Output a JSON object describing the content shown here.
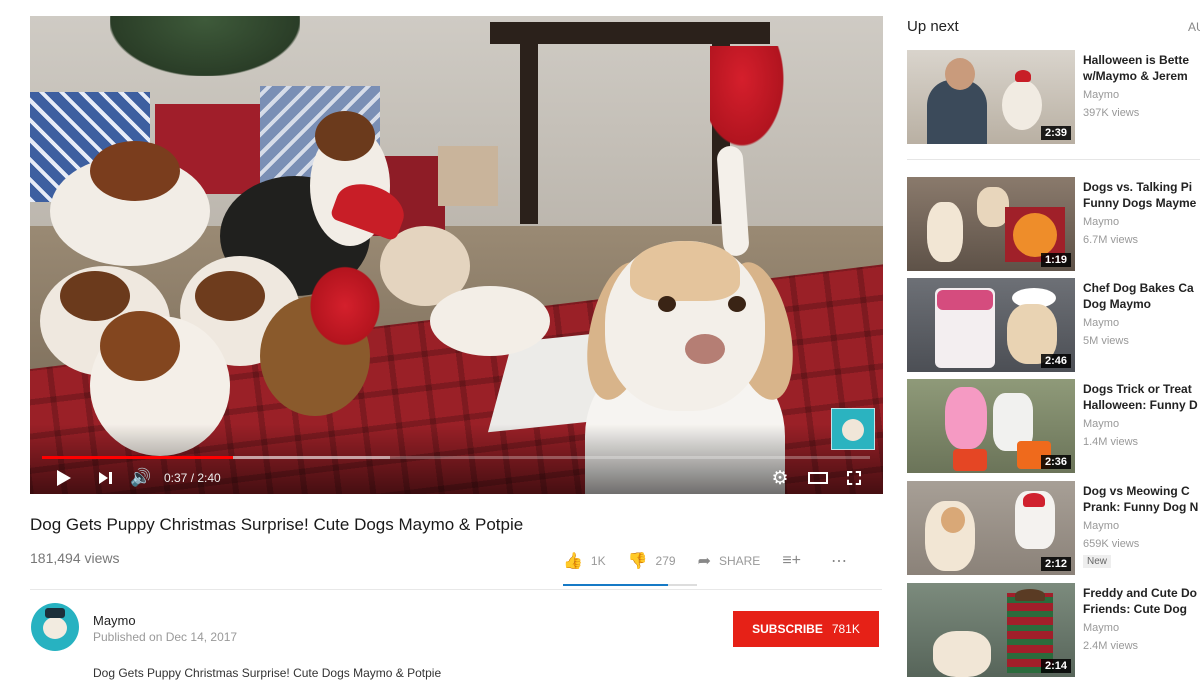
{
  "player": {
    "time_display": "0:37 / 2:40",
    "progress_played_fraction": 0.231,
    "progress_loaded_fraction": 0.42
  },
  "video": {
    "title": "Dog Gets Puppy Christmas Surprise! Cute Dogs Maymo & Potpie",
    "views": "181,494 views",
    "likes": "1K",
    "dislikes": "279",
    "share_label": "SHARE",
    "like_ratio": 0.78
  },
  "channel": {
    "name": "Maymo",
    "published": "Published on Dec 14, 2017",
    "subscribe_label": "SUBSCRIBE",
    "subscriber_count": "781K"
  },
  "description_line": "Dog Gets Puppy Christmas Surprise! Cute Dogs Maymo & Potpie",
  "sidebar": {
    "up_next_label": "Up next",
    "autoplay_label": "AU",
    "items": [
      {
        "title": "Halloween is Bette\nw/Maymo & Jerem",
        "channel": "Maymo",
        "views": "397K views",
        "duration": "2:39",
        "badge": ""
      },
      {
        "title": "Dogs vs. Talking Pi\nFunny Dogs Mayme",
        "channel": "Maymo",
        "views": "6.7M views",
        "duration": "1:19",
        "badge": ""
      },
      {
        "title": "Chef Dog Bakes Ca\nDog Maymo",
        "channel": "Maymo",
        "views": "5M views",
        "duration": "2:46",
        "badge": ""
      },
      {
        "title": "Dogs Trick or Treat\nHalloween: Funny D",
        "channel": "Maymo",
        "views": "1.4M views",
        "duration": "2:36",
        "badge": ""
      },
      {
        "title": "Dog vs Meowing C\nPrank: Funny Dog N",
        "channel": "Maymo",
        "views": "659K views",
        "duration": "2:12",
        "badge": "New"
      },
      {
        "title": "Freddy and Cute Do\nFriends: Cute Dog",
        "channel": "Maymo",
        "views": "2.4M views",
        "duration": "2:14",
        "badge": ""
      }
    ]
  },
  "colors": {
    "subscribe_red": "#e62117",
    "progress_red": "#ff0000",
    "like_bar_blue": "#167ac6"
  }
}
